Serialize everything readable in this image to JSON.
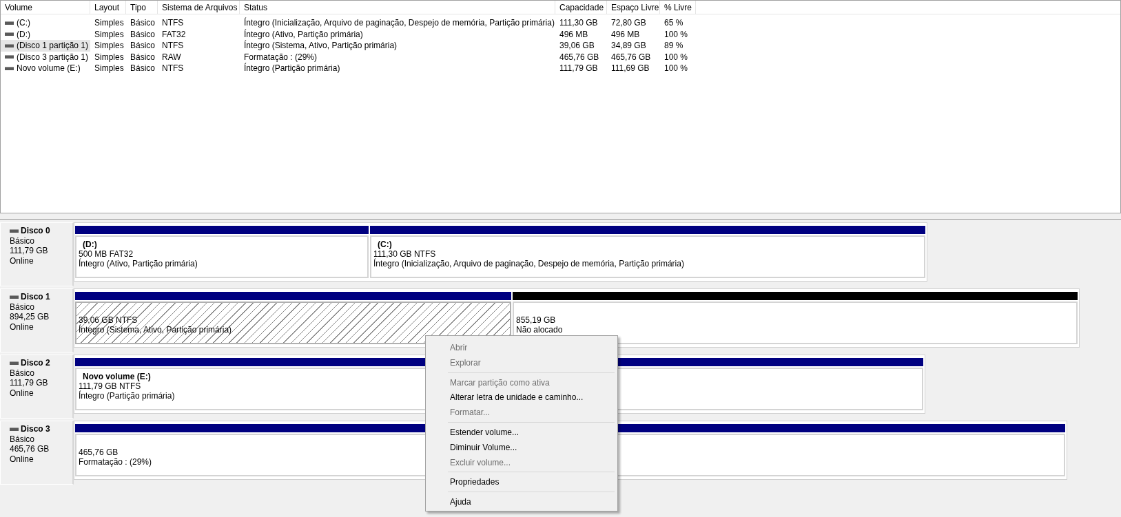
{
  "table": {
    "columns": [
      "Volume",
      "Layout",
      "Tipo",
      "Sistema de Arquivos",
      "Status",
      "Capacidade",
      "Espaço Livre",
      "% Livre"
    ],
    "rows": [
      {
        "cells": [
          "(C:)",
          "Simples",
          "Básico",
          "NTFS",
          "Íntegro (Inicialização, Arquivo de paginação, Despejo de memória, Partição primária)",
          "111,30 GB",
          "72,80 GB",
          "65 %"
        ],
        "selected": false
      },
      {
        "cells": [
          "(D:)",
          "Simples",
          "Básico",
          "FAT32",
          "Íntegro (Ativo, Partição primária)",
          "496 MB",
          "496 MB",
          "100 %"
        ],
        "selected": false
      },
      {
        "cells": [
          "(Disco 1 partição 1)",
          "Simples",
          "Básico",
          "NTFS",
          "Íntegro (Sistema, Ativo, Partição primária)",
          "39,06 GB",
          "34,89 GB",
          "89 %"
        ],
        "selected": true
      },
      {
        "cells": [
          "(Disco 3 partição 1)",
          "Simples",
          "Básico",
          "RAW",
          "Formatação : (29%)",
          "465,76 GB",
          "465,76 GB",
          "100 %"
        ],
        "selected": false
      },
      {
        "cells": [
          "Novo volume (E:)",
          "Simples",
          "Básico",
          "NTFS",
          "Íntegro (Partição primária)",
          "111,79 GB",
          "111,69 GB",
          "100 %"
        ],
        "selected": false
      }
    ]
  },
  "disks": [
    {
      "name": "Disco 0",
      "type": "Básico",
      "size": "111,79 GB",
      "status": "Online",
      "partitions": [
        {
          "kind": "primary",
          "selected": false,
          "title": "(D:)",
          "size": "500 MB FAT32",
          "status": "Íntegro (Ativo, Partição primária)"
        },
        {
          "kind": "primary",
          "selected": false,
          "title": "(C:)",
          "size": "111,30 GB NTFS",
          "status": "Íntegro (Inicialização, Arquivo de paginação, Despejo de memória, Partição primária)"
        }
      ]
    },
    {
      "name": "Disco 1",
      "type": "Básico",
      "size": "894,25 GB",
      "status": "Online",
      "partitions": [
        {
          "kind": "primary",
          "selected": true,
          "size": "39,06 GB NTFS",
          "status": "Íntegro (Sistema, Ativo, Partição primária)"
        },
        {
          "kind": "unallocated",
          "selected": false,
          "size": "855,19 GB",
          "status": "Não alocado"
        }
      ]
    },
    {
      "name": "Disco 2",
      "type": "Básico",
      "size": "111,79 GB",
      "status": "Online",
      "partitions": [
        {
          "kind": "primary",
          "selected": false,
          "title": "Novo volume  (E:)",
          "size": "111,79 GB NTFS",
          "status": "Íntegro (Partição primária)"
        }
      ]
    },
    {
      "name": "Disco 3",
      "type": "Básico",
      "size": "465,76 GB",
      "status": "Online",
      "partitions": [
        {
          "kind": "primary",
          "selected": false,
          "size": "465,76 GB",
          "status": "Formatação : (29%)"
        }
      ]
    }
  ],
  "context_menu": {
    "groups": [
      [
        {
          "label": "Abrir",
          "disabled": true
        },
        {
          "label": "Explorar",
          "disabled": true
        }
      ],
      [
        {
          "label": "Marcar partição como ativa",
          "disabled": true
        },
        {
          "label": "Alterar letra de unidade e caminho...",
          "disabled": false
        },
        {
          "label": "Formatar...",
          "disabled": true
        }
      ],
      [
        {
          "label": "Estender volume...",
          "disabled": false
        },
        {
          "label": "Diminuir Volume...",
          "disabled": false
        },
        {
          "label": "Excluir volume...",
          "disabled": true
        }
      ],
      [
        {
          "label": "Propriedades",
          "disabled": false
        }
      ],
      [
        {
          "label": "Ajuda",
          "disabled": false
        }
      ]
    ]
  }
}
